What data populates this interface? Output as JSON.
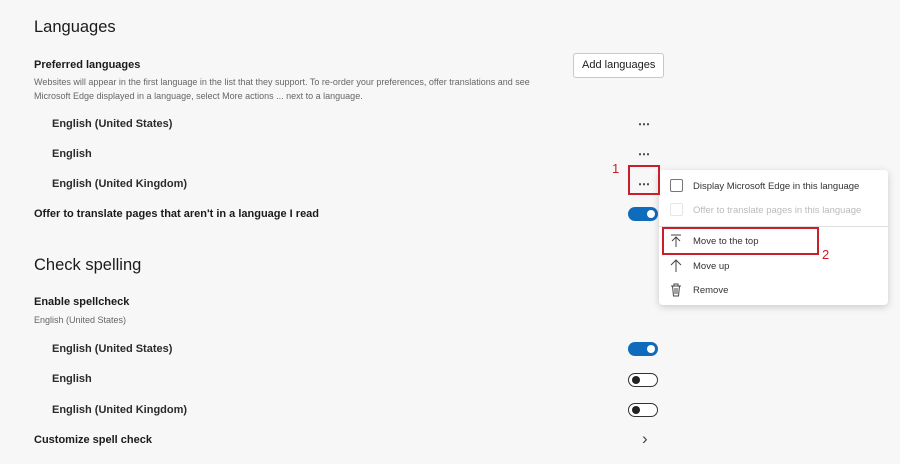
{
  "languages": {
    "title": "Languages",
    "preferred_label": "Preferred languages",
    "description_line1": "Websites will appear in the first language in the list that they support. To re-order your preferences, offer translations and see",
    "description_line2": "Microsoft Edge displayed in a language, select More actions ... next to a language.",
    "add_button": "Add languages",
    "items": [
      {
        "label": "English (United States)",
        "more": "⋯"
      },
      {
        "label": "English",
        "more": "⋯"
      },
      {
        "label": "English (United Kingdom)",
        "more": "⋯"
      }
    ],
    "offer_translate": {
      "label": "Offer to translate pages that aren't in a language I read",
      "on": true
    }
  },
  "spelling": {
    "title": "Check spelling",
    "enable_label": "Enable spellcheck",
    "enable_sub": "English (United States)",
    "items": [
      {
        "label": "English (United States)",
        "on": true
      },
      {
        "label": "English",
        "on": false
      },
      {
        "label": "English (United Kingdom)",
        "on": false
      }
    ],
    "customize_label": "Customize spell check",
    "chevron": "›"
  },
  "menu": {
    "display_edge": "Display Microsoft Edge in this language",
    "offer_translate": "Offer to translate pages in this language",
    "move_top": "Move to the top",
    "move_up": "Move up",
    "remove": "Remove"
  },
  "annotations": {
    "step1": "1",
    "step2": "2"
  },
  "colors": {
    "accent": "#0f6cbd",
    "annotation": "#c8202a"
  }
}
